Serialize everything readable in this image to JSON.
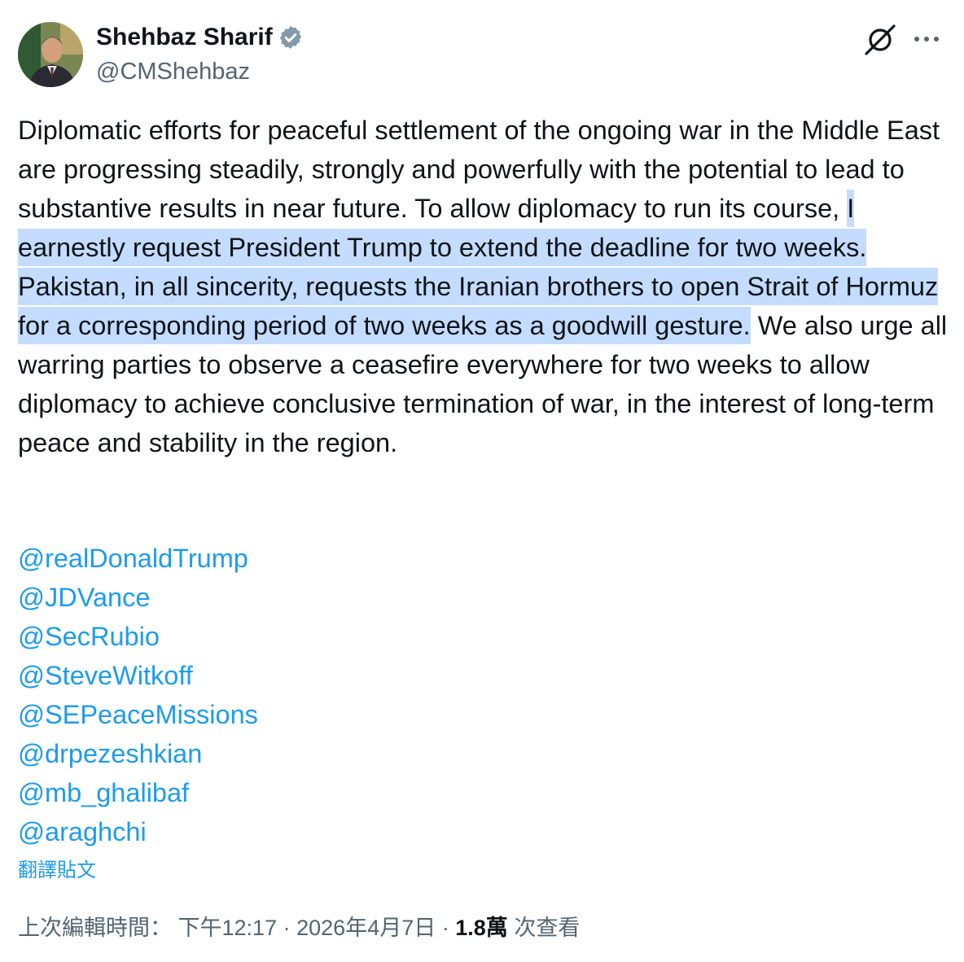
{
  "author": {
    "display_name": "Shehbaz Sharif",
    "handle": "@CMShehbaz",
    "avatar_icon": "profile-photo",
    "verified_icon": "verified-badge-icon",
    "verified_color": "#829aab"
  },
  "header_actions": {
    "grok_icon": "grok-icon",
    "more_icon": "more-horizontal-icon"
  },
  "tweet": {
    "text_before_highlight": "Diplomatic efforts for peaceful settlement of the ongoing war in the Middle East are progressing steadily, strongly and powerfully with the potential to lead to substantive results in near future. To allow diplomacy to run its course, ",
    "text_highlighted": "I earnestly request President Trump to extend the deadline for two weeks. Pakistan, in all sincerity, requests the Iranian brothers to open Strait of Hormuz for a corresponding period of two weeks as a goodwill gesture.",
    "text_after_highlight": " We also urge all warring parties to observe a ceasefire everywhere for two weeks to allow diplomacy to achieve conclusive termination of war, in the interest of long-term peace and stability in the region.",
    "highlight_color": "#c4dcff",
    "mentions": [
      "@realDonaldTrump",
      "@JDVance",
      "@SecRubio",
      "@SteveWitkoff",
      "@SEPeaceMissions",
      "@drpezeshkian",
      "@mb_ghalibaf",
      "@araghchi"
    ],
    "translate_label": "翻譯貼文",
    "link_color": "#1d9bf0"
  },
  "meta": {
    "edited_label": "上次編輯時間：",
    "time": "下午12:17",
    "separator": "·",
    "date": "2026年4月7日",
    "views_count": "1.8萬",
    "views_label": "次查看"
  }
}
